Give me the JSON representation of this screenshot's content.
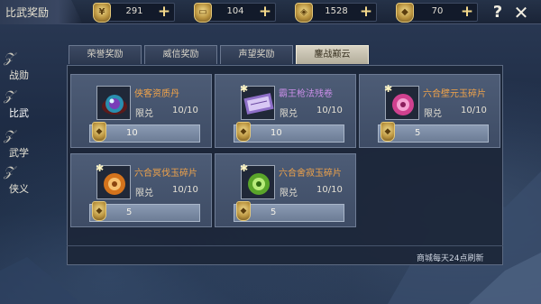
{
  "header": {
    "title": "比武奖励",
    "currencies": [
      {
        "icon": "jade-coin-icon",
        "value": "291"
      },
      {
        "icon": "scroll-icon",
        "value": "104"
      },
      {
        "icon": "jade-token-icon",
        "value": "1528"
      },
      {
        "icon": "gold-token-icon",
        "value": "70"
      }
    ],
    "help": "?",
    "close": "✕"
  },
  "sidenav": [
    {
      "label": "战勋",
      "active": false
    },
    {
      "label": "比武",
      "active": true
    },
    {
      "label": "武学",
      "active": false
    },
    {
      "label": "侠义",
      "active": false
    }
  ],
  "tabs": [
    {
      "label": "荣誉奖励",
      "active": false
    },
    {
      "label": "威信奖励",
      "active": false
    },
    {
      "label": "声望奖励",
      "active": false
    },
    {
      "label": "鏖战巅云",
      "active": true
    }
  ],
  "items": [
    {
      "name": "侠客资质丹",
      "limit_label": "限兑",
      "count": "10/10",
      "price": "10",
      "icon": "eye-pill-icon",
      "color": "orange"
    },
    {
      "name": "霸王枪法残卷",
      "limit_label": "限兑",
      "count": "10/10",
      "price": "10",
      "icon": "scroll-fragment-icon",
      "color": "purple"
    },
    {
      "name": "六合壁元玉碎片",
      "limit_label": "限兑",
      "count": "10/10",
      "price": "5",
      "icon": "pink-jade-icon",
      "color": "orange"
    },
    {
      "name": "六合冥伐玉碎片",
      "limit_label": "限兑",
      "count": "10/10",
      "price": "5",
      "icon": "orange-jade-icon",
      "color": "orange"
    },
    {
      "name": "六合舍寂玉碎片",
      "limit_label": "限兑",
      "count": "10/10",
      "price": "5",
      "icon": "green-jade-icon",
      "color": "orange"
    }
  ],
  "footer": {
    "refresh_note": "商城每天24点刷新"
  },
  "colors": {
    "accent_orange": "#f0a34a",
    "accent_purple": "#c98ee8",
    "gold": "#e5c878"
  }
}
